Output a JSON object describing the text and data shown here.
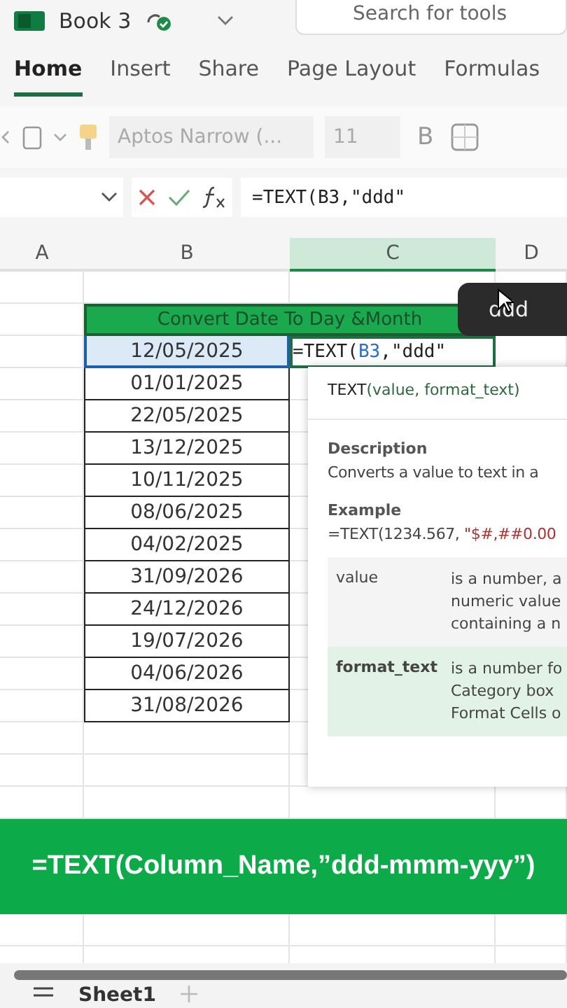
{
  "title_bar": {
    "file_name": "Book 3",
    "search": {
      "placeholder": "Search for tools"
    }
  },
  "tabs": [
    {
      "label": "Home",
      "selected": true
    },
    {
      "label": "Insert",
      "selected": false
    },
    {
      "label": "Share",
      "selected": false
    },
    {
      "label": "Page Layout",
      "selected": false
    },
    {
      "label": "Formulas",
      "selected": false
    }
  ],
  "toolbar": {
    "font": "Aptos Narrow (...",
    "size": "11",
    "bold": "B"
  },
  "formula_bar": {
    "formula": "=TEXT(B3,\"ddd\""
  },
  "columns": [
    {
      "label": "A",
      "selected": false
    },
    {
      "label": "B",
      "selected": false
    },
    {
      "label": "C",
      "selected": true
    },
    {
      "label": "D",
      "selected": false
    }
  ],
  "table": {
    "title": "Convert Date To Day &Month",
    "editing_formula_prefix": "=TEXT(",
    "editing_formula_ref": "B3",
    "editing_formula_suffix": ",\"ddd\"",
    "dates": [
      {
        "value": "12/05/2025",
        "selected": true
      },
      {
        "value": "01/01/2025",
        "selected": false
      },
      {
        "value": "22/05/2025",
        "selected": false
      },
      {
        "value": "13/12/2025",
        "selected": false
      },
      {
        "value": "10/11/2025",
        "selected": false
      },
      {
        "value": "08/06/2025",
        "selected": false
      },
      {
        "value": "04/02/2025",
        "selected": false
      },
      {
        "value": "31/09/2026",
        "selected": false
      },
      {
        "value": "24/12/2026",
        "selected": false
      },
      {
        "value": "19/07/2026",
        "selected": false
      },
      {
        "value": "04/06/2026",
        "selected": false
      },
      {
        "value": "31/08/2026",
        "selected": false
      }
    ]
  },
  "autocomplete_tip": "ddd",
  "function_help": {
    "name": "TEXT",
    "args": "(value, format_text)",
    "description_title": "Description",
    "description": "Converts a value to text in a",
    "example_title": "Example",
    "example_prefix": "=TEXT(1234.567, ",
    "example_arg": "\"$#,##0.00",
    "params": [
      {
        "name": "value",
        "lines": [
          "is a number, a",
          "numeric value",
          "containing a n"
        ],
        "selected": false
      },
      {
        "name": "format_text",
        "lines": [
          "is a number fo",
          "Category box",
          "Format Cells o"
        ],
        "selected": true
      }
    ]
  },
  "banner": "=TEXT(Column_Name,”ddd-mmm-yyy”)",
  "sheet_tabs": [
    {
      "label": "Sheet1",
      "selected": true
    }
  ]
}
